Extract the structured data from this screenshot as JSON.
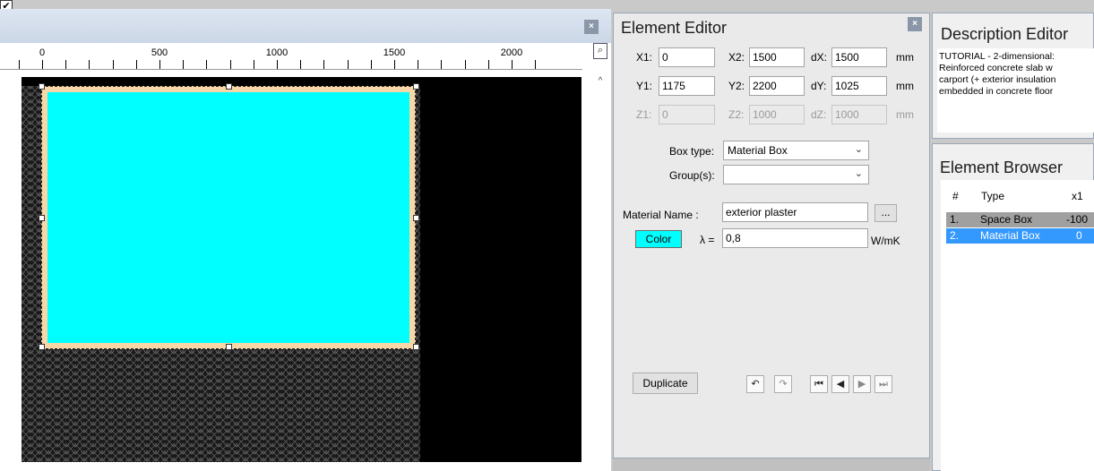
{
  "canvas": {
    "ruler_labels": [
      "0",
      "500",
      "1000",
      "1500",
      "2000"
    ],
    "close_glyph": "×",
    "icons": {
      "zoom": "zoom-fit-icon",
      "scroll_up": "scroll-up-icon"
    },
    "colors": {
      "material_fill": "#00ffff",
      "material_border": "#f7d7a8",
      "background": "#000000"
    }
  },
  "element_editor": {
    "title": "Element Editor",
    "close_glyph": "×",
    "coords": {
      "x1_label": "X1:",
      "x1": "0",
      "x2_label": "X2:",
      "x2": "1500",
      "dx_label": "dX:",
      "dx": "1500",
      "y1_label": "Y1:",
      "y1": "1175",
      "y2_label": "Y2:",
      "y2": "2200",
      "dy_label": "dY:",
      "dy": "1025",
      "z1_label": "Z1:",
      "z1": "0",
      "z2_label": "Z2:",
      "z2": "1000",
      "dz_label": "dZ:",
      "dz": "1000",
      "unit": "mm"
    },
    "box_type_label": "Box type:",
    "box_type_value": "Material Box",
    "groups_label": "Group(s):",
    "groups_value": "",
    "material_name_label": "Material Name :",
    "material_name_value": "exterior plaster",
    "browse_label": "...",
    "color_label": "Color",
    "lambda_label": "λ =",
    "lambda_value": "0,8",
    "lambda_unit": "W/mK",
    "checkbox_checked": true,
    "checkbox_glyph": "✔",
    "duplicate_label": "Duplicate",
    "nav_icons": {
      "undo": "↶",
      "redo": "↷",
      "first": "⏮",
      "prev": "◀",
      "next": "▶",
      "last": "⏭"
    }
  },
  "description_editor": {
    "title": "Description Editor",
    "lines": [
      "TUTORIAL - 2-dimensional:",
      "Reinforced concrete slab w",
      "carport (+ exterior insulation",
      "embedded in concrete floor"
    ]
  },
  "element_browser": {
    "title": "Element Browser",
    "columns": [
      "#",
      "Type",
      "x1"
    ],
    "rows": [
      {
        "num": "1.",
        "type": "Space Box",
        "x1": "-100",
        "selected": false
      },
      {
        "num": "2.",
        "type": "Material Box",
        "x1": "0",
        "selected": true
      }
    ],
    "colors": {
      "row_gray": "#a0a0a0",
      "row_selected": "#3399ff"
    }
  }
}
